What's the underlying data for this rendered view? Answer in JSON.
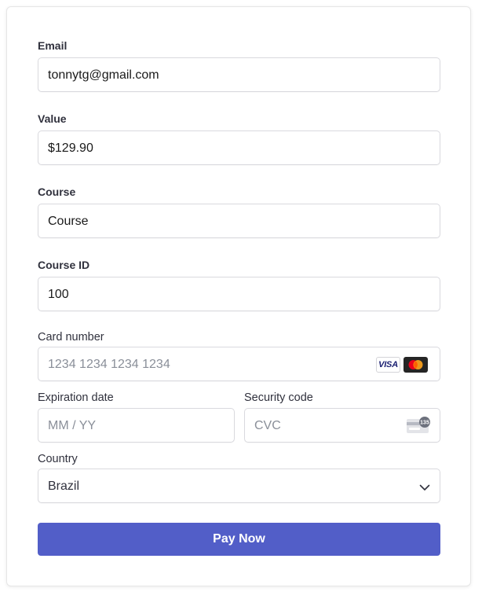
{
  "form": {
    "email": {
      "label": "Email",
      "value": "tonnytg@gmail.com"
    },
    "value": {
      "label": "Value",
      "value": "$129.90"
    },
    "course": {
      "label": "Course",
      "value": "Course"
    },
    "course_id": {
      "label": "Course ID",
      "value": "100"
    }
  },
  "payment": {
    "card_number": {
      "label": "Card number",
      "placeholder": "1234 1234 1234 1234"
    },
    "card_brands": {
      "visa": "VISA",
      "mastercard": "mastercard-icon"
    },
    "expiration": {
      "label": "Expiration date",
      "placeholder": "MM / YY"
    },
    "security_code": {
      "label": "Security code",
      "placeholder": "CVC",
      "icon_text": "135"
    },
    "country": {
      "label": "Country",
      "value": "Brazil"
    }
  },
  "actions": {
    "pay_label": "Pay Now"
  },
  "colors": {
    "button": "#525ec8",
    "border": "#d9d9de",
    "label": "#30313d",
    "placeholder": "#8a8f99"
  }
}
